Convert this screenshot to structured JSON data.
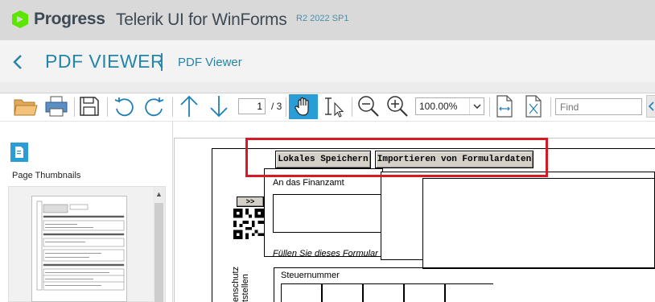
{
  "brand": {
    "company": "Progress",
    "product": "Telerik UI for WinForms",
    "version": "R2 2022 SP1"
  },
  "header": {
    "title": "PDF VIEWER",
    "separator": "|",
    "subtitle": "PDF Viewer"
  },
  "toolbar": {
    "page_current": "1",
    "page_total": "/ 3",
    "zoom": "100.00%",
    "find_placeholder": "Find"
  },
  "left_panel": {
    "tab_label": "Page Thumbnails"
  },
  "document": {
    "save_button": "Lokales Speichern",
    "import_button": "Importieren von Formulardaten",
    "expand_button": ">>",
    "finanzamt_label": "An das Finanzamt",
    "fill_instruction": "Füllen Sie dieses Formular",
    "tax_number_label": "Steuernummer",
    "vertical_text_1": "enschutz",
    "vertical_text_2": "tstellen"
  },
  "colors": {
    "accent": "#2385a8",
    "highlight": "#d61a25",
    "brand_bg": "#d9d9d9"
  }
}
